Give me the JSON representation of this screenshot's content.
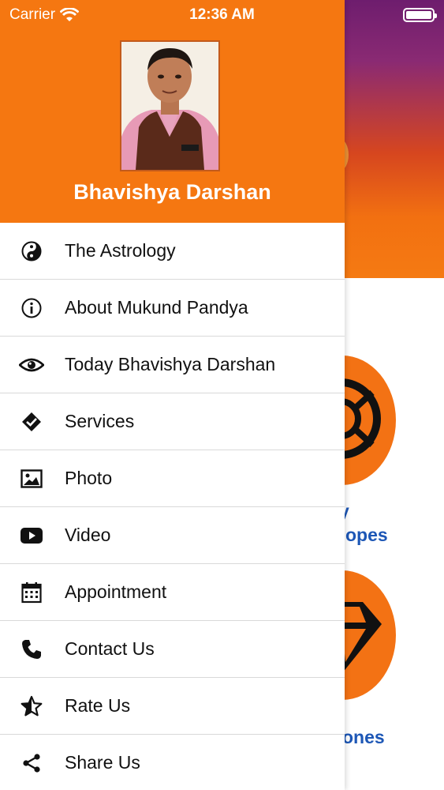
{
  "status_bar": {
    "carrier": "Carrier",
    "time": "12:36 AM"
  },
  "drawer": {
    "title": "Bhavishya Darshan",
    "menu": [
      {
        "label": "The Astrology",
        "icon": "yin-yang-icon"
      },
      {
        "label": "About Mukund Pandya",
        "icon": "info-icon"
      },
      {
        "label": "Today Bhavishya Darshan",
        "icon": "eye-icon"
      },
      {
        "label": "Services",
        "icon": "layers-check-icon"
      },
      {
        "label": "Photo",
        "icon": "photo-icon"
      },
      {
        "label": "Video",
        "icon": "youtube-icon"
      },
      {
        "label": "Appointment",
        "icon": "calendar-icon"
      },
      {
        "label": "Contact Us",
        "icon": "phone-icon"
      },
      {
        "label": "Rate Us",
        "icon": "star-half-icon"
      },
      {
        "label": "Share Us",
        "icon": "share-icon"
      }
    ]
  },
  "background": {
    "caption_1a": "y",
    "caption_1b": "opes",
    "caption_2": "ones"
  },
  "colors": {
    "brand_orange": "#f57711",
    "link_blue": "#1d57b6",
    "header_purple": "#6e1d6e"
  }
}
